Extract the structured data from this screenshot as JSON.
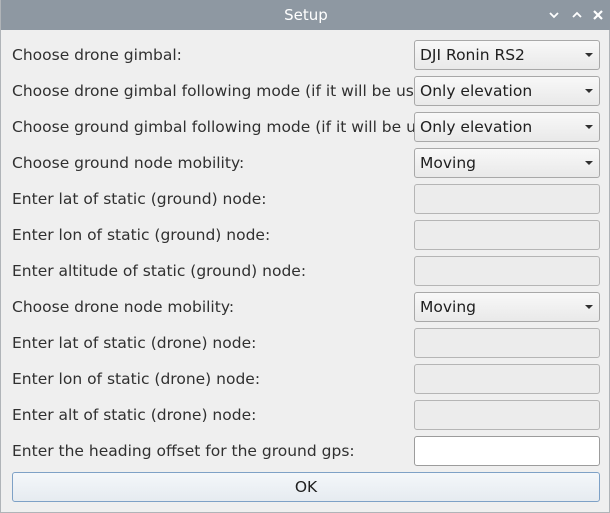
{
  "window": {
    "title": "Setup",
    "buttons": {
      "minimize": "chevron-down-icon",
      "maximize": "chevron-up-icon",
      "close": "close-icon"
    },
    "colors": {
      "titlebar": "#8e98a2",
      "background": "#efefef",
      "ok_border": "#7ea1c6"
    }
  },
  "form": {
    "drone_gimbal": {
      "label": "Choose drone gimbal:",
      "value": "DJI Ronin RS2"
    },
    "drone_gimbal_mode": {
      "label": "Choose drone gimbal following mode (if it will be used):",
      "value": "Only elevation"
    },
    "ground_gimbal_mode": {
      "label": "Choose ground gimbal following mode (if it will be used):",
      "value": "Only elevation"
    },
    "ground_mobility": {
      "label": "Choose ground node mobility:",
      "value": "Moving"
    },
    "ground_lat": {
      "label": "Enter lat of static (ground) node:",
      "value": ""
    },
    "ground_lon": {
      "label": "Enter lon of static (ground) node:",
      "value": ""
    },
    "ground_alt": {
      "label": "Enter altitude of static (ground) node:",
      "value": ""
    },
    "drone_mobility": {
      "label": "Choose drone node mobility:",
      "value": "Moving"
    },
    "drone_lat": {
      "label": "Enter lat of static (drone) node:",
      "value": ""
    },
    "drone_lon": {
      "label": "Enter lon of static (drone) node:",
      "value": ""
    },
    "drone_alt": {
      "label": "Enter alt of static (drone) node:",
      "value": ""
    },
    "heading_offset": {
      "label": "Enter the heading offset for the ground gps:",
      "value": ""
    }
  },
  "ok_button": {
    "label": "OK"
  }
}
